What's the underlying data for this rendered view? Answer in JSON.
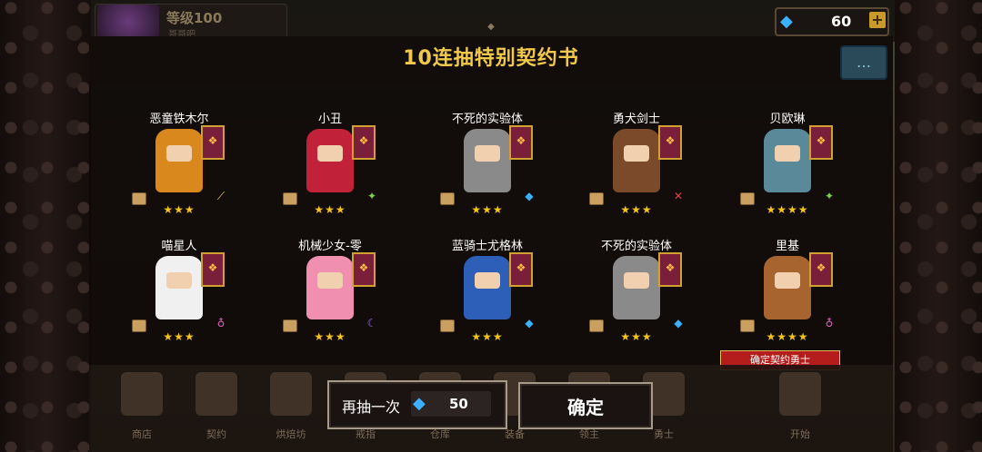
{
  "player": {
    "level": "等级100",
    "subtitle": "哥哥吧"
  },
  "currency": {
    "gems": "60",
    "plus": "+"
  },
  "modal": {
    "title": "10连抽特别契约书",
    "heroes": [
      {
        "name": "恶童铁木尔",
        "stars": "★★★",
        "color": "#d9881e",
        "weapon": "⟋",
        "weapon_color": "#f0d040"
      },
      {
        "name": "小丑",
        "stars": "★★★",
        "color": "#c2213a",
        "weapon": "✦",
        "weapon_color": "#7fd04a"
      },
      {
        "name": "不死的实验体",
        "stars": "★★★",
        "color": "#8a8a8a",
        "weapon": "◆",
        "weapon_color": "#3ab0ff"
      },
      {
        "name": "勇犬剑士",
        "stars": "★★★",
        "color": "#7a4a2a",
        "weapon": "✕",
        "weapon_color": "#e04040"
      },
      {
        "name": "贝欧琳",
        "stars": "★★★★",
        "color": "#5a8a9a",
        "weapon": "✦",
        "weapon_color": "#7fd04a"
      },
      {
        "name": "喵星人",
        "stars": "★★★",
        "color": "#f0f0f0",
        "weapon": "♁",
        "weapon_color": "#e060c0"
      },
      {
        "name": "机械少女-零",
        "stars": "★★★",
        "color": "#f08fb0",
        "weapon": "☾",
        "weapon_color": "#9a6ef0"
      },
      {
        "name": "蓝骑士尤格林",
        "stars": "★★★",
        "color": "#2d5fb8",
        "weapon": "◆",
        "weapon_color": "#3ab0ff"
      },
      {
        "name": "不死的实验体",
        "stars": "★★★",
        "color": "#8a8a8a",
        "weapon": "◆",
        "weapon_color": "#3ab0ff"
      },
      {
        "name": "里基",
        "stars": "★★★★",
        "color": "#a8642e",
        "weapon": "♁",
        "weapon_color": "#e060c0"
      }
    ],
    "confirm_tag": "确定契约勇士"
  },
  "buttons": {
    "again_label": "再抽一次",
    "again_cost": "50",
    "ok_label": "确定"
  },
  "nav": [
    "商店",
    "契约",
    "烘焙坊",
    "戒指",
    "仓库",
    "装备",
    "领主",
    "勇士",
    "开始"
  ]
}
